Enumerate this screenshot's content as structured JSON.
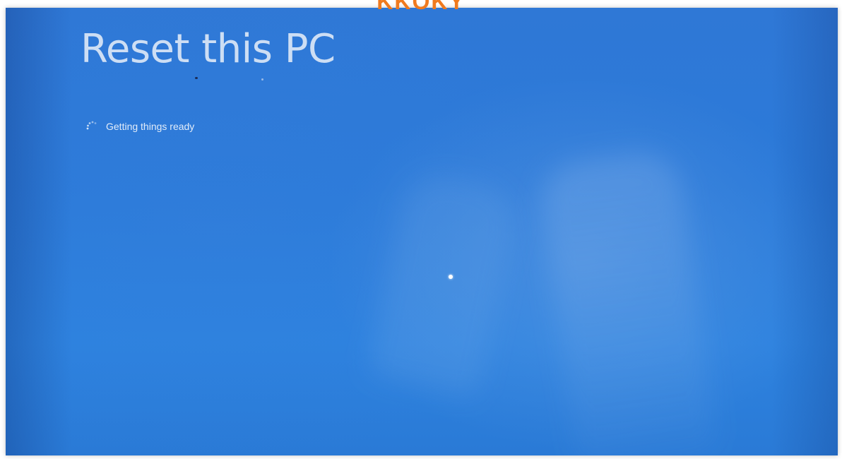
{
  "banner": {
    "text": "KKOKY"
  },
  "screen": {
    "title": "Reset this PC",
    "status": {
      "text": "Getting things ready",
      "icon": "loading-spinner-icon"
    }
  },
  "colors": {
    "background": "#2b7ad9",
    "title_text": "#dbe7f7",
    "banner_text": "#f07a1e"
  }
}
